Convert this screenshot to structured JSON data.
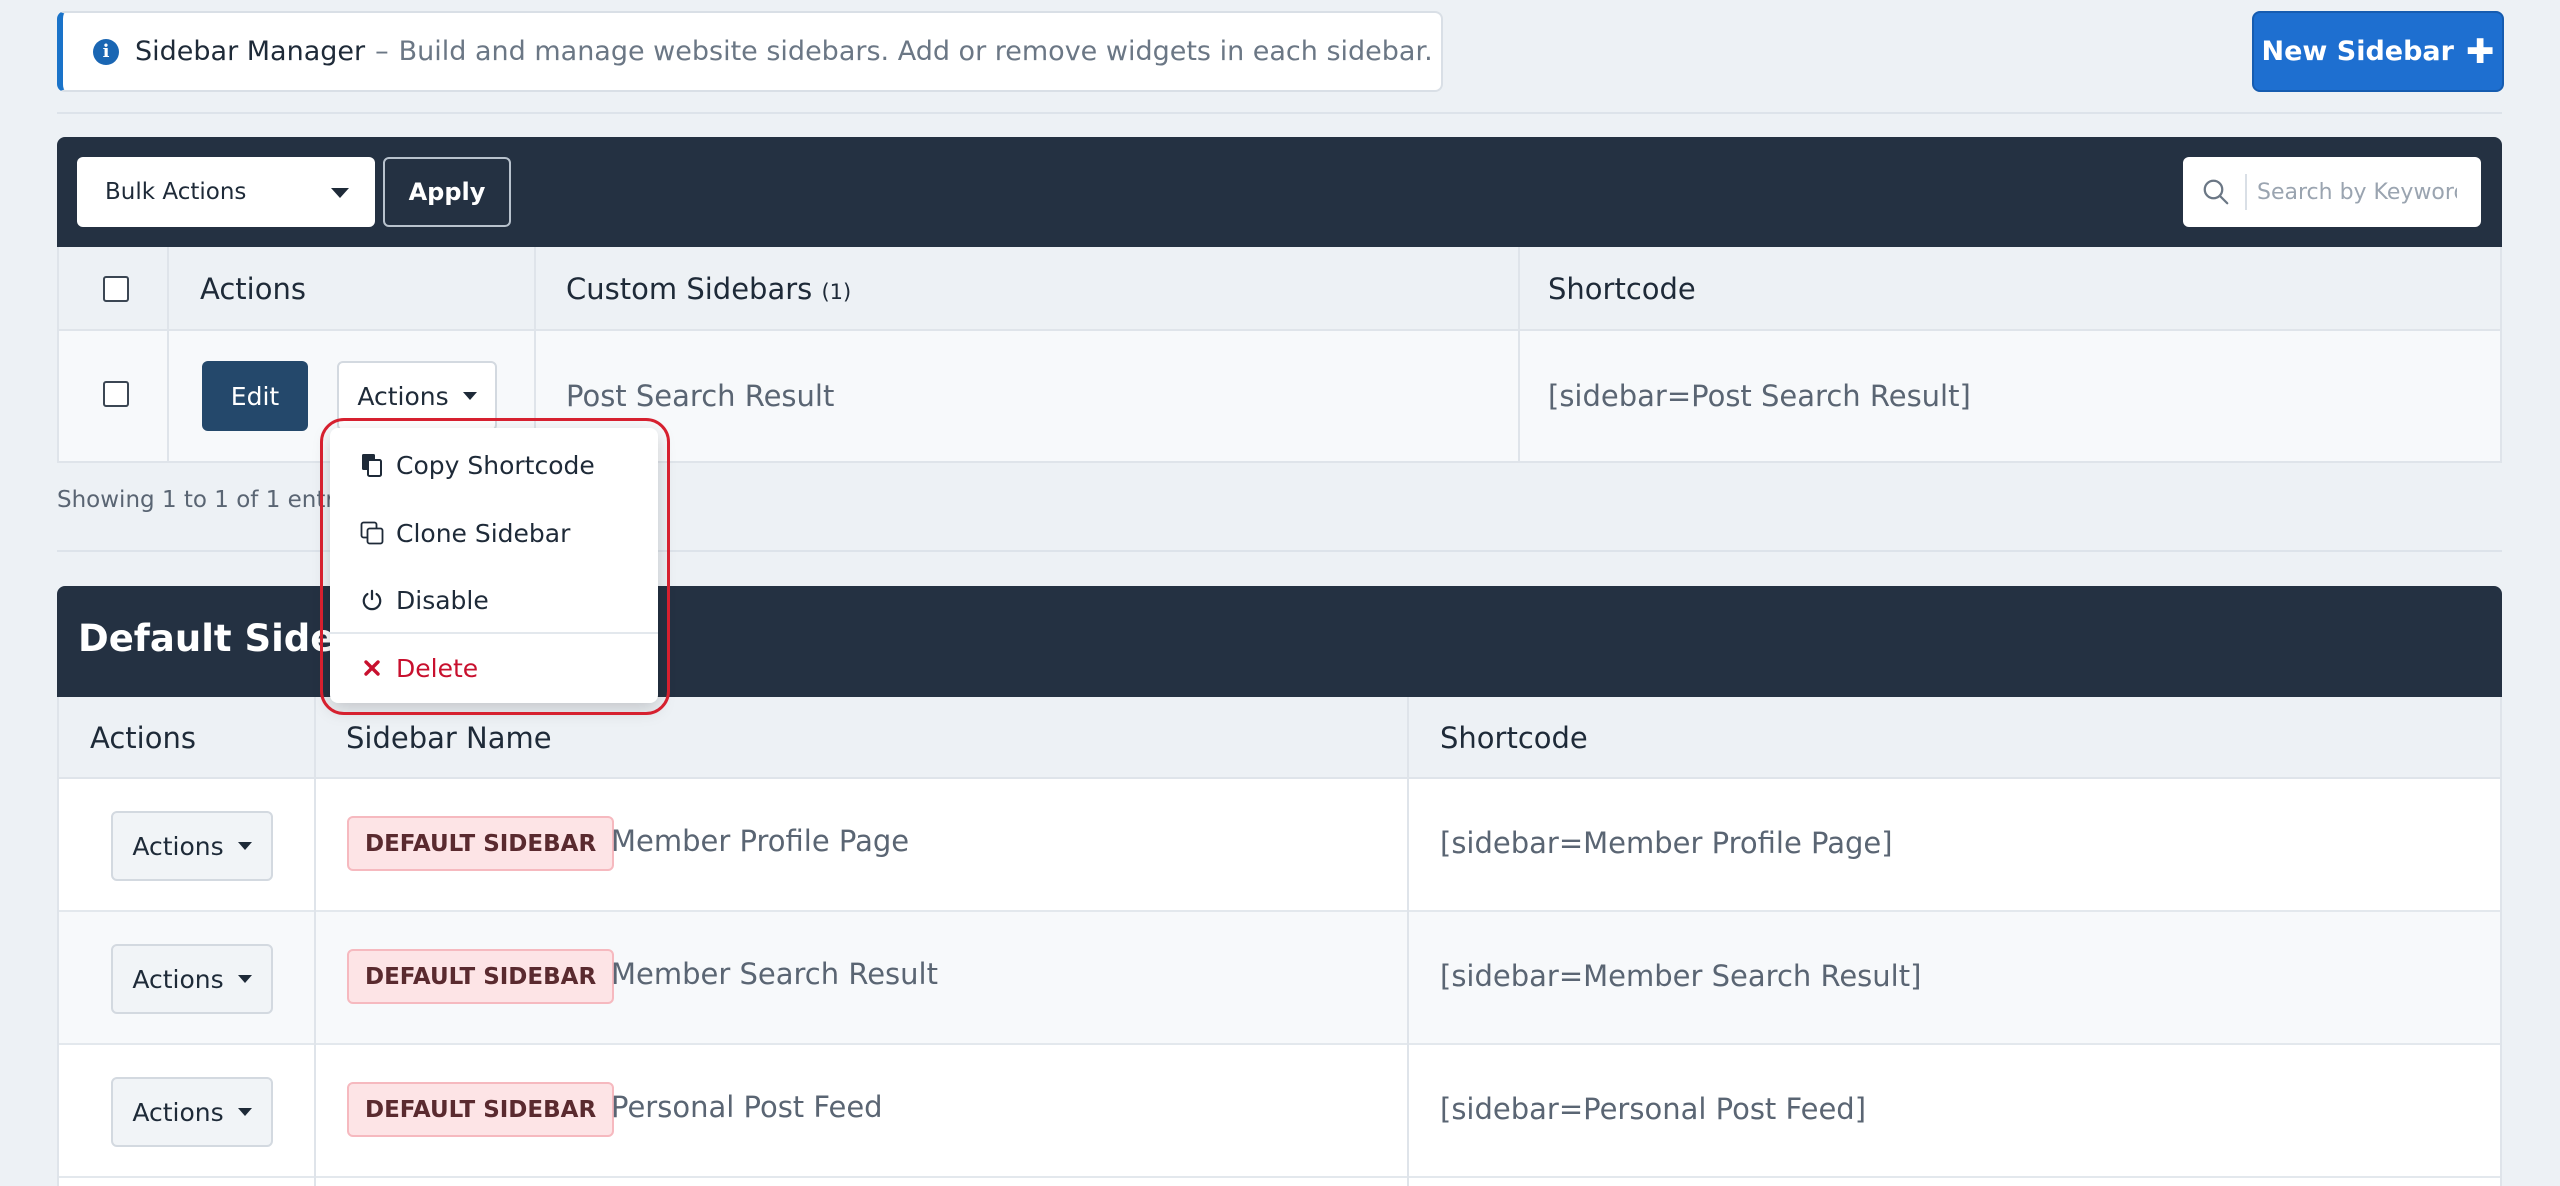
{
  "notice": {
    "title": "Sidebar Manager",
    "separator": "–",
    "description": "Build and manage website sidebars. Add or remove widgets in each sidebar."
  },
  "new_sidebar_button": "New Sidebar",
  "toolbar": {
    "bulk_actions": "Bulk Actions",
    "apply": "Apply",
    "search_placeholder": "Search by Keyword"
  },
  "custom_table": {
    "headers": {
      "actions": "Actions",
      "custom_sidebars": "Custom Sidebars",
      "count": "(1)",
      "shortcode": "Shortcode"
    },
    "rows": [
      {
        "edit": "Edit",
        "actions": "Actions",
        "name": "Post Search Result",
        "shortcode": "[sidebar=Post Search Result]"
      }
    ],
    "showing": "Showing 1 to 1 of 1 entries"
  },
  "dropdown": {
    "items": [
      {
        "label": "Copy Shortcode",
        "icon": "copy-icon"
      },
      {
        "label": "Clone Sidebar",
        "icon": "clone-icon"
      },
      {
        "label": "Disable",
        "icon": "power-icon"
      },
      {
        "label": "Delete",
        "icon": "close-icon"
      }
    ]
  },
  "default_panel": {
    "title": "Default Sidebars",
    "headers": {
      "actions": "Actions",
      "sidebar_name": "Sidebar Name",
      "shortcode": "Shortcode"
    },
    "rows": [
      {
        "actions": "Actions",
        "badge": "DEFAULT SIDEBAR",
        "name": "Member Profile Page",
        "shortcode": "[sidebar=Member Profile Page]"
      },
      {
        "actions": "Actions",
        "badge": "DEFAULT SIDEBAR",
        "name": "Member Search Result",
        "shortcode": "[sidebar=Member Search Result]"
      },
      {
        "actions": "Actions",
        "badge": "DEFAULT SIDEBAR",
        "name": "Personal Post Feed",
        "shortcode": "[sidebar=Personal Post Feed]"
      }
    ]
  },
  "colors": {
    "primary": "#1e6fd0",
    "dark_header": "#243142",
    "edit_button": "#24486b",
    "danger": "#c8102e",
    "highlight": "#d6202f"
  }
}
